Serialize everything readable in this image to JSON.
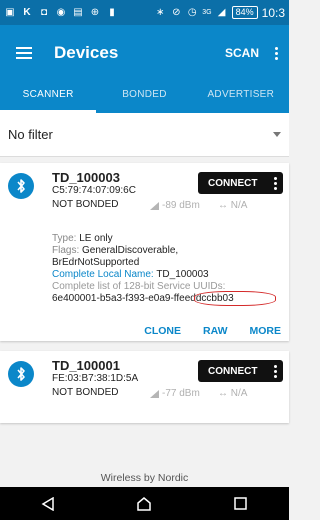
{
  "status": {
    "icons": [
      "screenshot-icon",
      "k-icon",
      "chat-icon",
      "camera-icon",
      "mail-icon",
      "globe-icon",
      "notification-icon",
      "bluetooth-icon",
      "dnd-icon",
      "alarm-icon",
      "signal-icon"
    ],
    "network": "3G",
    "battery": "84%",
    "time": "10:3"
  },
  "appbar": {
    "title": "Devices",
    "scan_label": "SCAN"
  },
  "tabs": [
    {
      "label": "SCANNER",
      "active": true
    },
    {
      "label": "BONDED",
      "active": false
    },
    {
      "label": "ADVERTISER",
      "active": false
    }
  ],
  "filter": {
    "label": "No filter"
  },
  "devices": [
    {
      "name": "TD_100003",
      "address": "C5:79:74:07:09:6C",
      "bond": "NOT BONDED",
      "rssi": "-89 dBm",
      "interval": "↔ N/A",
      "connect_label": "CONNECT",
      "details": {
        "type_label": "Type:",
        "type_value": "LE only",
        "flags_label": "Flags:",
        "flags_value": "GeneralDiscoverable, BrEdrNotSupported",
        "local_name_label": "Complete Local Name:",
        "local_name_value": "TD_100003",
        "uuid_label": "Complete list of 128-bit Service UUIDs:",
        "uuid_value": "6e400001-b5a3-f393-e0a9-ffeeddccbb03"
      },
      "actions": [
        "CLONE",
        "RAW",
        "MORE"
      ]
    },
    {
      "name": "TD_100001",
      "address": "FE:03:B7:38:1D:5A",
      "bond": "NOT BONDED",
      "rssi": "-77 dBm",
      "interval": "↔ N/A",
      "connect_label": "CONNECT"
    }
  ],
  "footer": {
    "text": "Wireless by Nordic"
  },
  "colors": {
    "status_bar": "#0b6fa8",
    "app_bar": "#0b87c9",
    "accent": "#0b87c9",
    "annotation": "#d42a2a"
  }
}
